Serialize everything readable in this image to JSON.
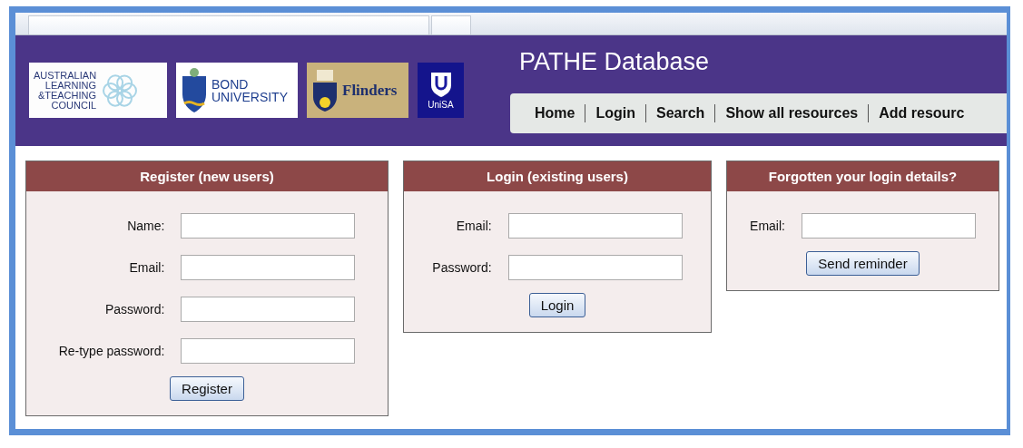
{
  "logos": [
    {
      "kind": "altc",
      "lines": [
        "AUSTRALIAN",
        "LEARNING",
        "&TEACHING",
        "COUNCIL"
      ]
    },
    {
      "kind": "bond",
      "lines": [
        "BOND",
        "UNIVERSITY"
      ]
    },
    {
      "kind": "flinders",
      "lines": [
        "Flinders"
      ]
    },
    {
      "kind": "unisa",
      "lines": [
        "UniSA"
      ]
    }
  ],
  "site_title": "PATHE Database",
  "nav": [
    "Home",
    "Login",
    "Search",
    "Show all resources",
    "Add resourc"
  ],
  "panels": [
    {
      "title": "Register (new users)",
      "fields": [
        {
          "label": "Name:"
        },
        {
          "label": "Email:"
        },
        {
          "label": "Password:"
        },
        {
          "label": "Re-type password:"
        }
      ],
      "button": "Register"
    },
    {
      "title": "Login (existing users)",
      "fields": [
        {
          "label": "Email:"
        },
        {
          "label": "Password:"
        }
      ],
      "button": "Login"
    },
    {
      "title": "Forgotten your login details?",
      "fields": [
        {
          "label": "Email:"
        }
      ],
      "button": "Send reminder"
    }
  ]
}
